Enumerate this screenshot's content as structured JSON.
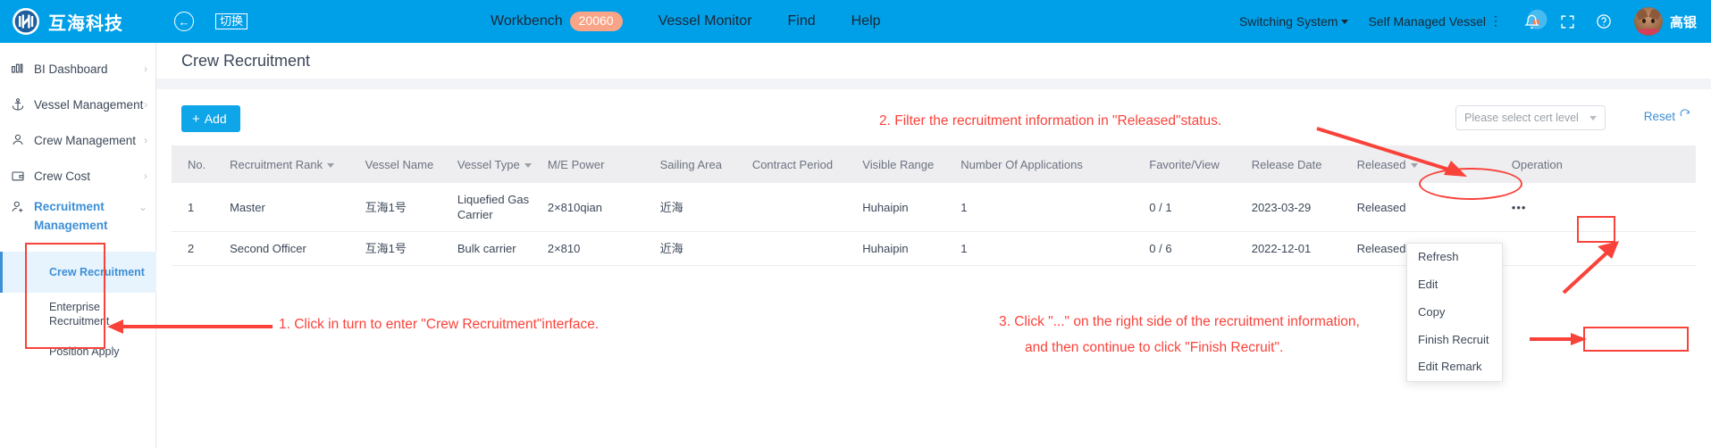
{
  "header": {
    "brand_name": "互海科技",
    "back_icon": "back-arrow-icon",
    "switch_label": "切换",
    "nav": [
      {
        "label": "Workbench",
        "badge": "20060"
      },
      {
        "label": "Vessel Monitor",
        "badge": ""
      },
      {
        "label": "Find",
        "badge": ""
      },
      {
        "label": "Help",
        "badge": ""
      }
    ],
    "switching_system": "Switching System",
    "self_managed_vessel": "Self Managed Vessel",
    "icons": [
      "bell-icon",
      "fullscreen-icon",
      "help-circle-icon"
    ],
    "user_name": "高银",
    "bar_color": "#00a0e9"
  },
  "sidebar": {
    "items": [
      {
        "label": "BI Dashboard",
        "icon": "bar-chart-icon",
        "chevron": "chevron-right-icon"
      },
      {
        "label": "Vessel Management",
        "icon": "anchor-icon",
        "chevron": "chevron-right-icon"
      },
      {
        "label": "Crew Management",
        "icon": "person-icon",
        "chevron": "chevron-right-icon"
      },
      {
        "label": "Crew Cost",
        "icon": "wallet-icon",
        "chevron": "chevron-right-icon"
      },
      {
        "label": "Recruitment Management",
        "icon": "person-add-icon",
        "chevron": "chevron-down-icon"
      }
    ],
    "sub_items": [
      {
        "label": "Crew Recruitment",
        "active": true
      },
      {
        "label": "Enterprise Recruitment",
        "active": false
      },
      {
        "label": "Position Apply",
        "active": false
      }
    ]
  },
  "main": {
    "page_title": "Crew Recruitment",
    "add_label": "Add",
    "cert_select_placeholder": "Please select cert level",
    "reset_label": "Reset",
    "reset_icon": "refresh-icon"
  },
  "table": {
    "columns": [
      {
        "label": "No.",
        "sortable": false
      },
      {
        "label": "Recruitment Rank",
        "sortable": true
      },
      {
        "label": "Vessel Name",
        "sortable": false
      },
      {
        "label": "Vessel Type",
        "sortable": true
      },
      {
        "label": "M/E Power",
        "sortable": false
      },
      {
        "label": "Sailing Area",
        "sortable": false
      },
      {
        "label": "Contract Period",
        "sortable": false
      },
      {
        "label": "Visible Range",
        "sortable": false
      },
      {
        "label": "Number Of Applications",
        "sortable": false
      },
      {
        "label": "Favorite/View",
        "sortable": false
      },
      {
        "label": "Release Date",
        "sortable": false
      },
      {
        "label": "Released",
        "sortable": true
      },
      {
        "label": "Operation",
        "sortable": false
      }
    ],
    "rows": [
      {
        "no": "1",
        "rank": "Master",
        "vessel_name": "互海1号",
        "vessel_type": "Liquefied Gas Carrier",
        "me_power": "2×810qian",
        "sailing_area": "近海",
        "contract_period": "",
        "visible_range": "Huhaipin",
        "applications": "1",
        "favorite_view": "0 / 1",
        "release_date": "2023-03-29",
        "status": "Released",
        "operation_icon": "more-horizontal-icon"
      },
      {
        "no": "2",
        "rank": "Second Officer",
        "vessel_name": "互海1号",
        "vessel_type": "Bulk carrier",
        "me_power": "2×810",
        "sailing_area": "近海",
        "contract_period": "",
        "visible_range": "Huhaipin",
        "applications": "1",
        "favorite_view": "0 / 6",
        "release_date": "2022-12-01",
        "status": "Released",
        "operation_icon": ""
      }
    ]
  },
  "context_menu": {
    "items": [
      {
        "label": "Refresh",
        "highlighted": false
      },
      {
        "label": "Edit",
        "highlighted": false
      },
      {
        "label": "Copy",
        "highlighted": false
      },
      {
        "label": "Finish Recruit",
        "highlighted": true
      },
      {
        "label": "Edit Remark",
        "highlighted": false
      }
    ]
  },
  "annotations": {
    "color": "#f9423a",
    "step1": "1. Click in turn to enter \"Crew Recruitment\"interface.",
    "step2": "2. Filter the recruitment information in \"Released\"status.",
    "step3_line1": "3. Click \"...\" on the right side of the recruitment information,",
    "step3_line2": "and then continue to click \"Finish Recruit\"."
  }
}
